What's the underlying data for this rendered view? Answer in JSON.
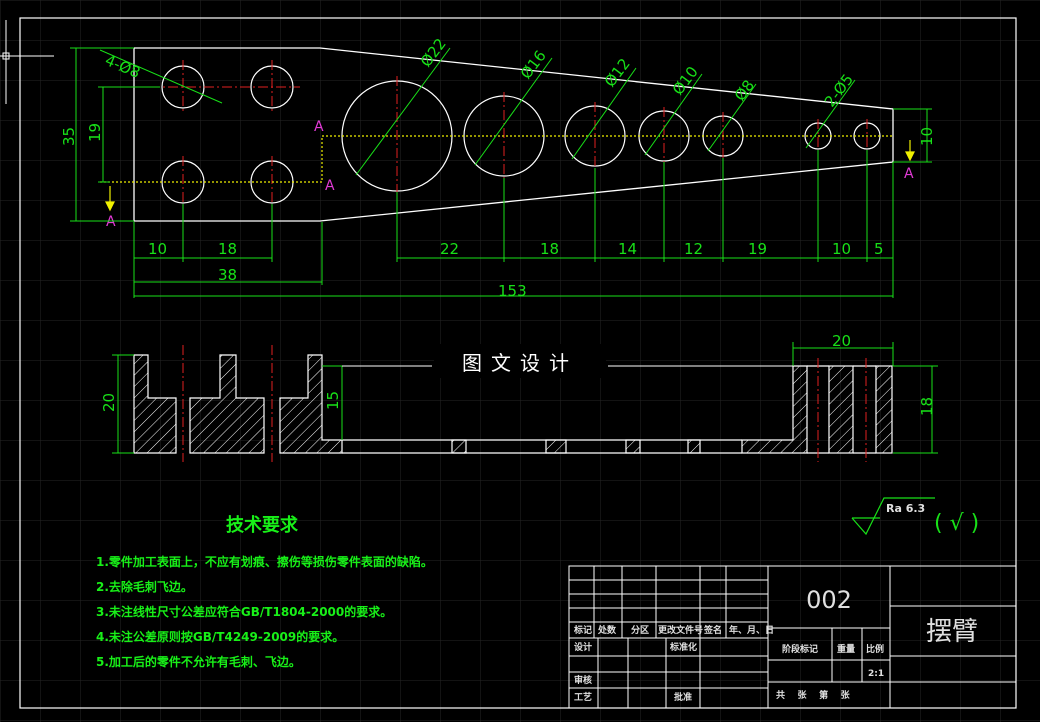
{
  "drawing": {
    "number": "002",
    "part_name": "摆臂",
    "scale": "2:1",
    "watermark": "图文设计"
  },
  "top_view": {
    "hole_callouts": [
      "4-Ø8",
      "Ø22",
      "Ø16",
      "Ø12",
      "Ø10",
      "Ø8",
      "2-Ø5"
    ],
    "section_marks": [
      "A",
      "A",
      "A",
      "A"
    ],
    "dims_bottom_row": [
      "10",
      "18",
      "22",
      "18",
      "14",
      "12",
      "19",
      "10",
      "5"
    ],
    "dim_38": "38",
    "dim_153": "153",
    "dim_35": "35",
    "dim_19": "19",
    "dim_10_right": "10"
  },
  "section_view": {
    "dim_20_left": "20",
    "dim_15": "15",
    "dim_20_top": "20",
    "dim_18": "18"
  },
  "surface_finish": {
    "ra": "Ra 6.3",
    "other": "( √ )"
  },
  "requirements": {
    "title": "技术要求",
    "items": [
      "1.零件加工表面上，不应有划痕、擦伤等损伤零件表面的缺陷。",
      "2.去除毛刺飞边。",
      "3.未注线性尺寸公差应符合GB/T1804-2000的要求。",
      "4.未注公差原则按GB/T4249-2009的要求。",
      "5.加工后的零件不允许有毛刺、飞边。"
    ]
  },
  "title_block": {
    "row_labels": [
      "标记",
      "处数",
      "分区",
      "更改文件号",
      "签名",
      "年、月、日"
    ],
    "design": "设计",
    "standardize": "标准化",
    "stage_mark": "阶段标记",
    "weight": "重量",
    "scale_label": "比例",
    "review": "审核",
    "process": "工艺",
    "approve": "批准",
    "sheets": "共    张    第    张"
  },
  "colors": {
    "background": "#000000",
    "outline": "#ffffff",
    "dimension": "#18e018",
    "center_line": "#e02020",
    "section_mark": "#e23ad6",
    "cut_line": "#f0f000",
    "grid": "#2a2a2a"
  }
}
